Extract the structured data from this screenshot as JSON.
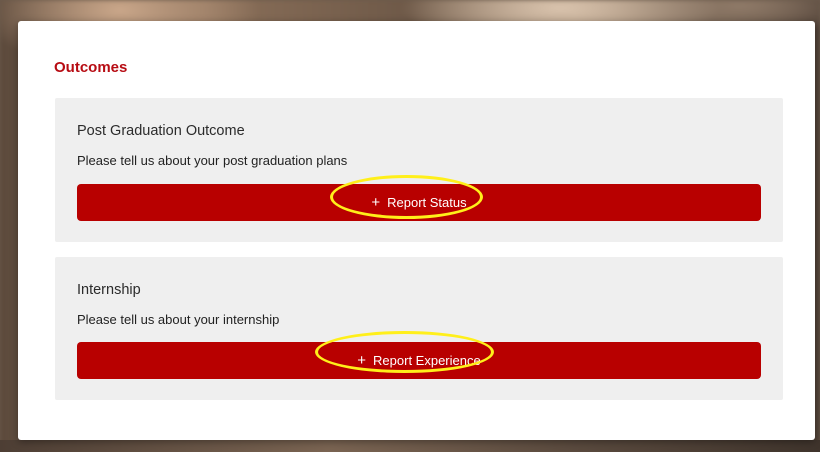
{
  "modal": {
    "title": "Outcomes"
  },
  "cards": [
    {
      "title": "Post Graduation Outcome",
      "description": "Please tell us about your post graduation plans",
      "button_icon": "+",
      "button_label": "Report Status"
    },
    {
      "title": "Internship",
      "description": "Please tell us about your internship",
      "button_icon": "+",
      "button_label": "Report Experience"
    }
  ],
  "colors": {
    "accent": "#b70c13",
    "button": "#b80000",
    "card_background": "#efefef",
    "highlight": "#ffef1a"
  }
}
